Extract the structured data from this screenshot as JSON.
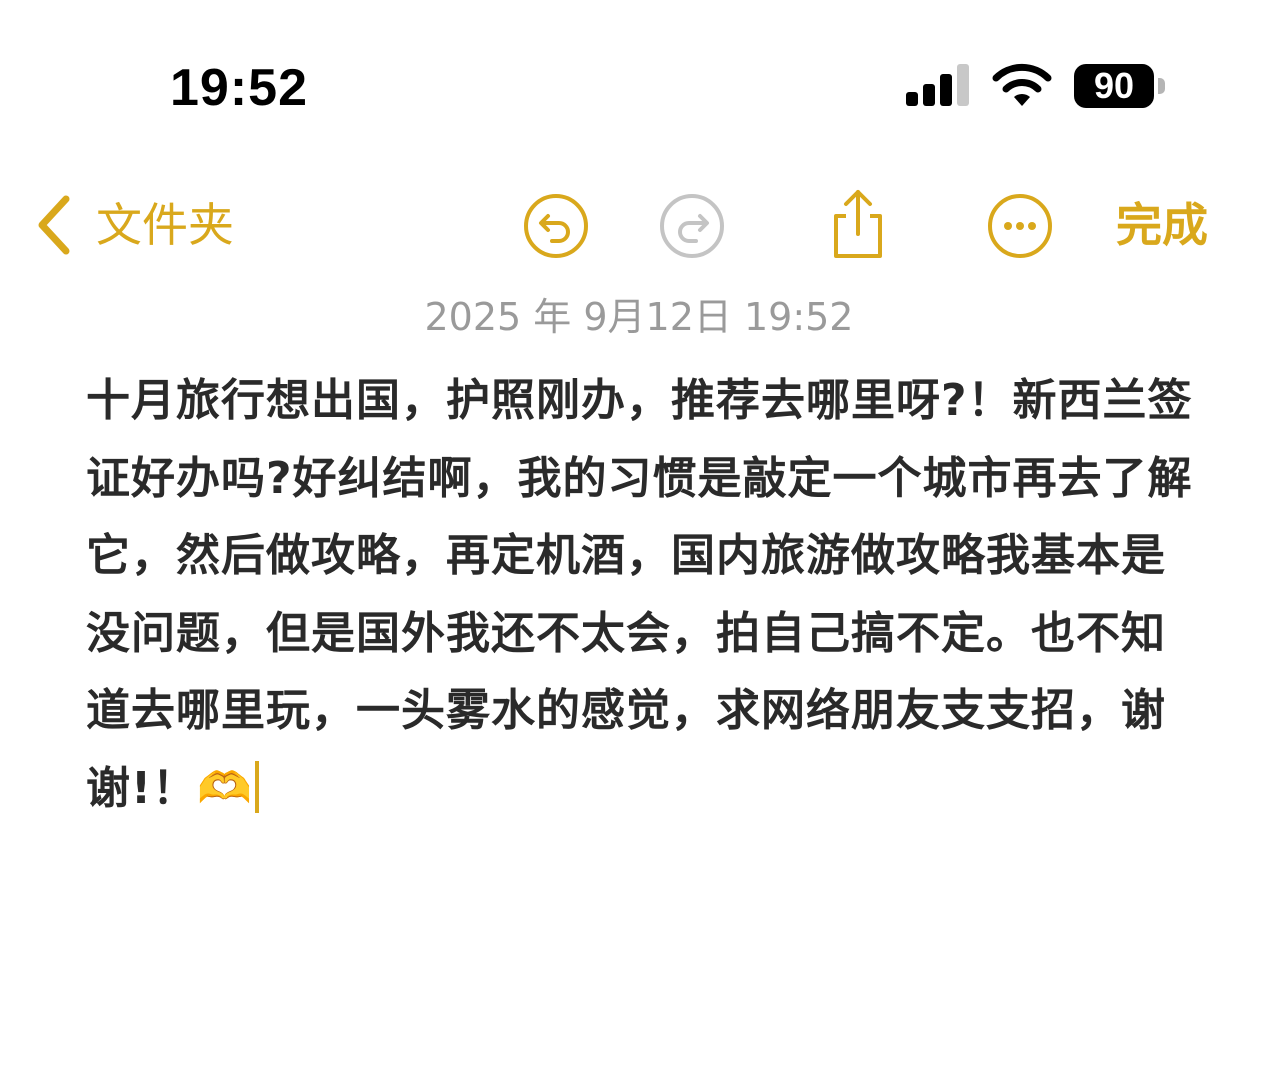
{
  "status_bar": {
    "time": "19:52",
    "battery": "90",
    "icons": [
      "cellular-signal-icon",
      "wifi-icon",
      "battery-icon"
    ]
  },
  "nav": {
    "back_label": "文件夹",
    "done_label": "完成",
    "icons": [
      "chevron-left-icon",
      "undo-icon",
      "redo-icon",
      "share-icon",
      "more-icon"
    ]
  },
  "note": {
    "date": "2025 年 9月12日 19:52",
    "body": "十月旅行想出国，护照刚办，推荐去哪里呀?！新西兰签证好办吗?好纠结啊，我的习惯是敲定一个城市再去了解它，然后做攻略，再定机酒，国内旅游做攻略我基本是没问题，但是国外我还不太会，拍自己搞不定。也不知道去哪里玩，一头雾水的感觉，求网络朋友支支招，谢谢!！🫶"
  },
  "colors": {
    "accent": "#d9a81c",
    "disabled": "#c4c4c4",
    "date_text": "#9a9a9a",
    "body_text": "#2a2a2a"
  }
}
